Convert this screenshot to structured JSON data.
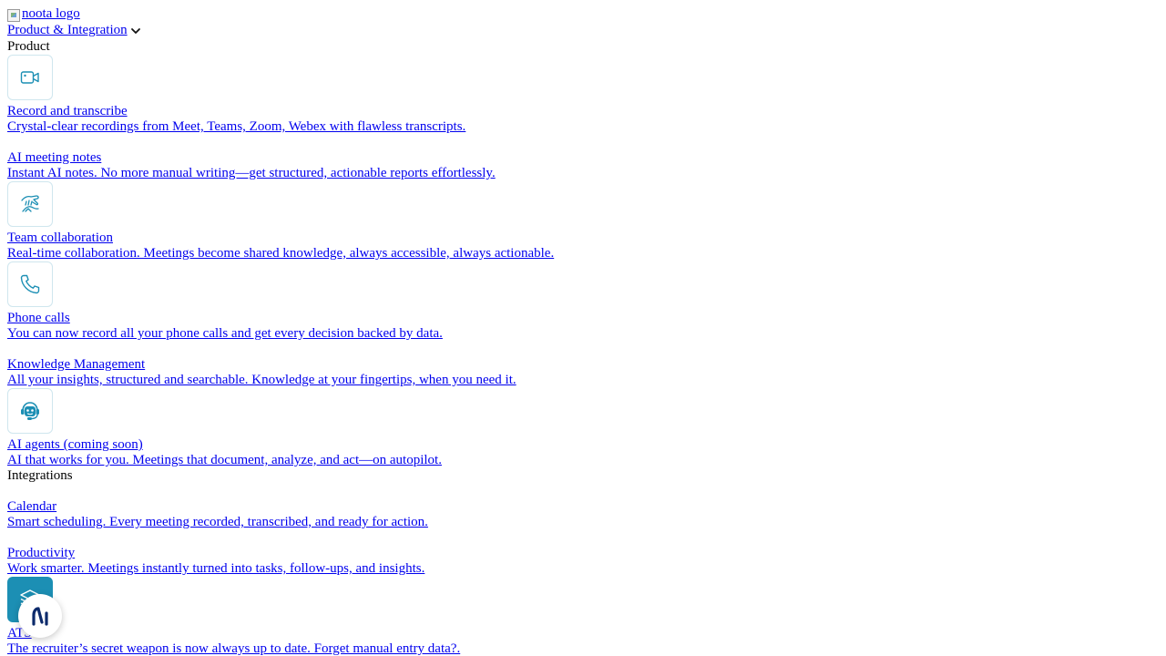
{
  "header": {
    "logo_alt": "noota logo",
    "nav_label": "Product & Integration",
    "nav_icon": "chevron-down-icon"
  },
  "sections": {
    "product_label": "Product",
    "integrations_label": "Integrations"
  },
  "product_items": [
    {
      "title": "Record and transcribe",
      "description": " Crystal-clear recordings from Meet, Teams, Zoom, Webex with  flawless transcripts.",
      "icon": "video-camera-icon"
    },
    {
      "title": "AI meeting notes",
      "description": "Instant AI notes. No more manual writing—get structured, actionable reports effortlessly.",
      "icon": ""
    },
    {
      "title": "Team collaboration",
      "description": "Real-time collaboration. Meetings become shared knowledge, always accessible, always actionable.",
      "icon": "team-hands-icon"
    },
    {
      "title": "Phone calls",
      "description": "You can now record all your phone calls and get every decision backed by data.",
      "icon": "phone-icon"
    },
    {
      "title": "Knowledge Management",
      "description": "All your insights, structured and searchable. Knowledge at your fingertips, when you need it.",
      "icon": ""
    },
    {
      "title": "AI agents (coming soon)",
      "description": "AI that works for you. Meetings that document, analyze, and act—on autopilot.",
      "icon": "robot-headset-icon"
    }
  ],
  "integration_items": [
    {
      "title": "Calendar",
      "description": " Smart scheduling. Every meeting recorded, transcribed, and ready for action.",
      "icon": ""
    },
    {
      "title": "Productivity",
      "description": "Work smarter. Meetings instantly turned into tasks, follow-ups, and insights.",
      "icon": ""
    },
    {
      "title": "ATS",
      "description": " The recruiter’s secret weapon is now always up to date. Forget manual entry data?.",
      "icon": "ats-layers-icon"
    }
  ],
  "floating_button": {
    "icon": "noota-chat-icon"
  },
  "colors": {
    "link": "#0000ee",
    "icon_stroke": "#1c8fb4",
    "icon_box_border": "#cfe6ee",
    "ats_icon_fill": "#1c8fb4"
  }
}
